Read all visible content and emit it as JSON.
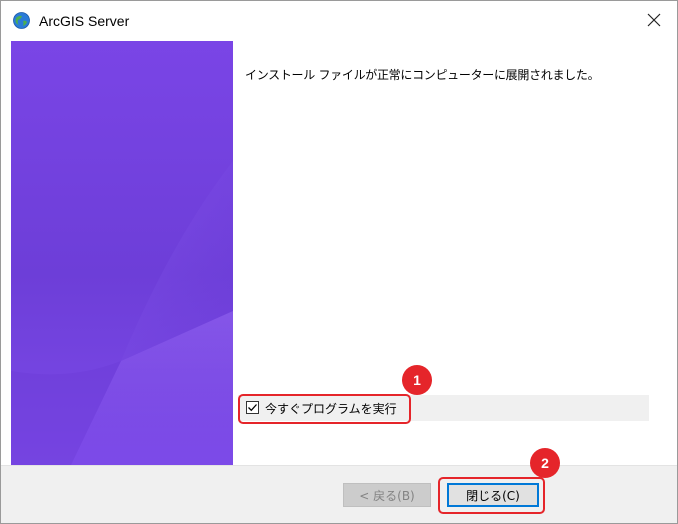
{
  "window": {
    "title": "ArcGIS Server",
    "icon": "globe-icon",
    "close_icon": "close-icon"
  },
  "main": {
    "message": "インストール ファイルが正常にコンピューターに展開されました。"
  },
  "run_option": {
    "label": "今すぐプログラムを実行",
    "checked": true
  },
  "footer": {
    "back_label": "< 戻る(B)",
    "back_enabled": false,
    "close_label": "閉じる(C)"
  },
  "annotations": [
    {
      "number": "1",
      "target": "run-now-checkbox"
    },
    {
      "number": "2",
      "target": "close-dialog-button"
    }
  ],
  "colors": {
    "banner": "#7a45e6",
    "highlight": "#e5252a",
    "focus": "#0078d7"
  }
}
